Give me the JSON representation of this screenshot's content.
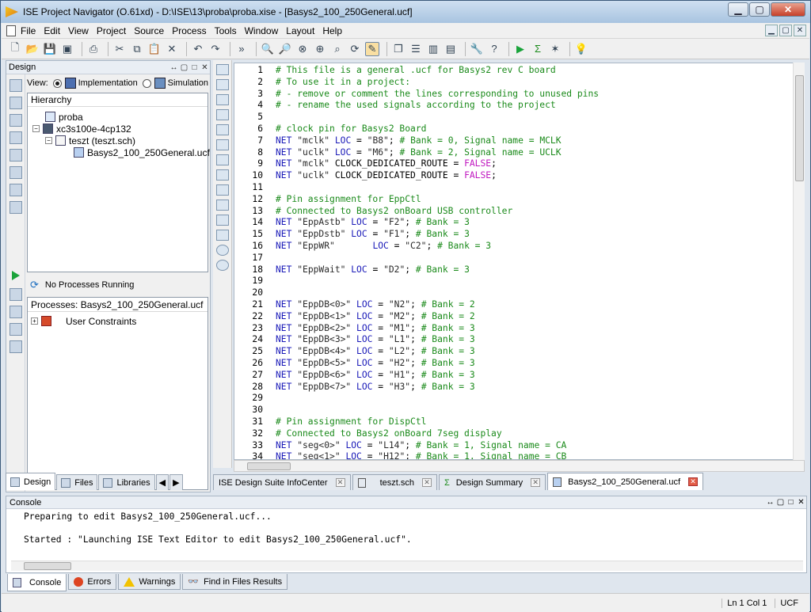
{
  "window": {
    "title": "ISE Project Navigator (O.61xd) - D:\\ISE\\13\\proba\\proba.xise - [Basys2_100_250General.ucf]"
  },
  "menu": [
    {
      "label": "File"
    },
    {
      "label": "Edit"
    },
    {
      "label": "View"
    },
    {
      "label": "Project"
    },
    {
      "label": "Source"
    },
    {
      "label": "Process"
    },
    {
      "label": "Tools"
    },
    {
      "label": "Window"
    },
    {
      "label": "Layout"
    },
    {
      "label": "Help"
    }
  ],
  "toolbar": {
    "overflow": "»"
  },
  "design": {
    "title": "Design",
    "view_label": "View:",
    "implementation": "Implementation",
    "simulation": "Simulation",
    "hierarchy_label": "Hierarchy",
    "tree": [
      {
        "label": "proba",
        "depth": 0,
        "expand": ""
      },
      {
        "label": "xc3s100e-4cp132",
        "depth": 0,
        "expand": "−"
      },
      {
        "label": "teszt (teszt.sch)",
        "depth": 1,
        "expand": "−"
      },
      {
        "label": "Basys2_100_250General.ucf",
        "depth": 2,
        "expand": ""
      }
    ],
    "processes_status": "No Processes Running",
    "processes_label": "Processes: Basys2_100_250General.ucf",
    "process_item": "User Constraints"
  },
  "left_tabs": [
    {
      "label": "Design"
    },
    {
      "label": "Files"
    },
    {
      "label": "Libraries"
    }
  ],
  "editor_tabs": [
    {
      "label": "ISE Design Suite InfoCenter"
    },
    {
      "label": "teszt.sch"
    },
    {
      "label": "Design Summary"
    },
    {
      "label": "Basys2_100_250General.ucf"
    }
  ],
  "code_lines": [
    {
      "n": "1",
      "t": "# This file is a general .ucf for Basys2 rev C board"
    },
    {
      "n": "2",
      "t": "# To use it in a project:"
    },
    {
      "n": "3",
      "t": "# - remove or comment the lines corresponding to unused pins"
    },
    {
      "n": "4",
      "t": "# - rename the used signals according to the project"
    },
    {
      "n": "5",
      "t": ""
    },
    {
      "n": "6",
      "t": "# clock pin for Basys2 Board"
    },
    {
      "n": "7",
      "t": "NET \"mclk\" LOC = \"B8\"; # Bank = 0, Signal name = MCLK"
    },
    {
      "n": "8",
      "t": "NET \"uclk\" LOC = \"M6\"; # Bank = 2, Signal name = UCLK"
    },
    {
      "n": "9",
      "t": "NET \"mclk\" CLOCK_DEDICATED_ROUTE = FALSE;"
    },
    {
      "n": "10",
      "t": "NET \"uclk\" CLOCK_DEDICATED_ROUTE = FALSE;"
    },
    {
      "n": "11",
      "t": ""
    },
    {
      "n": "12",
      "t": "# Pin assignment for EppCtl"
    },
    {
      "n": "13",
      "t": "# Connected to Basys2 onBoard USB controller"
    },
    {
      "n": "14",
      "t": "NET \"EppAstb\" LOC = \"F2\"; # Bank = 3"
    },
    {
      "n": "15",
      "t": "NET \"EppDstb\" LOC = \"F1\"; # Bank = 3"
    },
    {
      "n": "16",
      "t": "NET \"EppWR\"       LOC = \"C2\"; # Bank = 3"
    },
    {
      "n": "17",
      "t": ""
    },
    {
      "n": "18",
      "t": "NET \"EppWait\" LOC = \"D2\"; # Bank = 3"
    },
    {
      "n": "19",
      "t": ""
    },
    {
      "n": "20",
      "t": ""
    },
    {
      "n": "21",
      "t": "NET \"EppDB<0>\" LOC = \"N2\"; # Bank = 2"
    },
    {
      "n": "22",
      "t": "NET \"EppDB<1>\" LOC = \"M2\"; # Bank = 2"
    },
    {
      "n": "23",
      "t": "NET \"EppDB<2>\" LOC = \"M1\"; # Bank = 3"
    },
    {
      "n": "24",
      "t": "NET \"EppDB<3>\" LOC = \"L1\"; # Bank = 3"
    },
    {
      "n": "25",
      "t": "NET \"EppDB<4>\" LOC = \"L2\"; # Bank = 3"
    },
    {
      "n": "26",
      "t": "NET \"EppDB<5>\" LOC = \"H2\"; # Bank = 3"
    },
    {
      "n": "27",
      "t": "NET \"EppDB<6>\" LOC = \"H1\"; # Bank = 3"
    },
    {
      "n": "28",
      "t": "NET \"EppDB<7>\" LOC = \"H3\"; # Bank = 3"
    },
    {
      "n": "29",
      "t": ""
    },
    {
      "n": "30",
      "t": ""
    },
    {
      "n": "31",
      "t": "# Pin assignment for DispCtl"
    },
    {
      "n": "32",
      "t": "# Connected to Basys2 onBoard 7seg display"
    },
    {
      "n": "33",
      "t": "NET \"seg<0>\" LOC = \"L14\"; # Bank = 1, Signal name = CA"
    },
    {
      "n": "34",
      "t": "NET \"seg<1>\" LOC = \"H12\"; # Bank = 1, Signal name = CB"
    }
  ],
  "console": {
    "title": "Console",
    "lines": [
      "Preparing to edit Basys2_100_250General.ucf...",
      "",
      "Started : \"Launching ISE Text Editor to edit Basys2_100_250General.ucf\"."
    ]
  },
  "console_tabs": [
    {
      "label": "Console"
    },
    {
      "label": "Errors"
    },
    {
      "label": "Warnings"
    },
    {
      "label": "Find in Files Results"
    }
  ],
  "status": {
    "position": "Ln 1 Col 1",
    "filetype": "UCF"
  },
  "colors": {
    "comment": "#1a8a1a",
    "keyword": "#1a1ab8",
    "literal": "#c018c0"
  }
}
